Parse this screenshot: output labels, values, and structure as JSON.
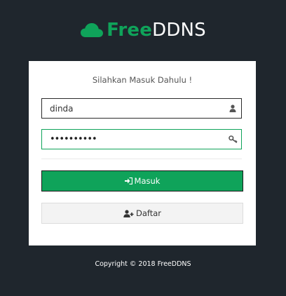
{
  "brand": {
    "name_strong": "Free",
    "name_light": "DDNS",
    "icon": "cloud-icon",
    "accent_color": "#0fa35a",
    "background_color": "#1f262d"
  },
  "login": {
    "heading": "Silahkan Masuk Dahulu !",
    "username_value": "dinda",
    "username_icon": "user-icon",
    "password_value": "••••••••••",
    "password_icon": "key-icon",
    "submit_label": "Masuk",
    "submit_icon": "sign-in-icon",
    "register_label": "Daftar",
    "register_icon": "user-plus-icon"
  },
  "footer": {
    "copyright": "Copyright © 2018 FreeDDNS"
  }
}
